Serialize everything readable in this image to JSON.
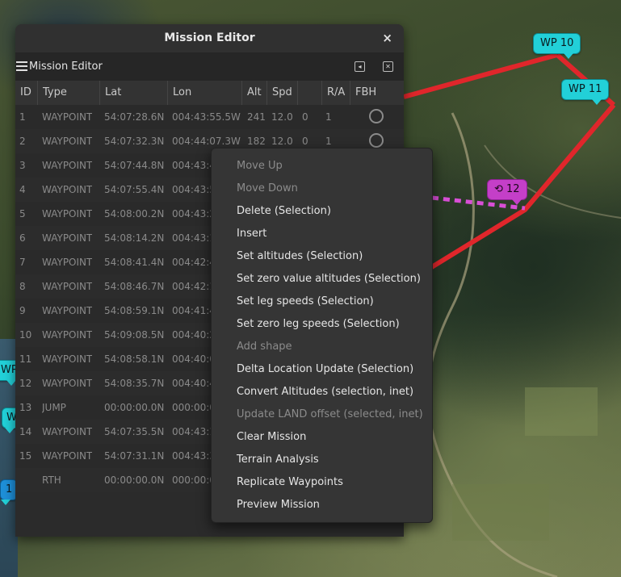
{
  "map": {
    "markers": [
      {
        "label": "WP 10"
      },
      {
        "label": "WP 11"
      },
      {
        "label": "⟲ 12"
      }
    ],
    "left_markers": [
      {
        "label": "WP"
      },
      {
        "label": "W"
      },
      {
        "label": "1"
      }
    ]
  },
  "window": {
    "title": "Mission Editor",
    "close_symbol": "×"
  },
  "editor": {
    "panel_title": "Mission Editor",
    "columns": [
      "ID",
      "Type",
      "Lat",
      "Lon",
      "Alt",
      "Spd",
      "",
      "R/A",
      "FBH"
    ],
    "rows": [
      {
        "id": "1",
        "type": "WAYPOINT",
        "lat": "54:07:28.6N",
        "lon": "004:43:55.5W",
        "alt": "241",
        "spd": "12.0",
        "p": "0",
        "ra": "1"
      },
      {
        "id": "2",
        "type": "WAYPOINT",
        "lat": "54:07:32.3N",
        "lon": "004:44:07.3W",
        "alt": "182",
        "spd": "12.0",
        "p": "0",
        "ra": "1"
      },
      {
        "id": "3",
        "type": "WAYPOINT",
        "lat": "54:07:44.8N",
        "lon": "004:43:4",
        "alt": "",
        "spd": "",
        "p": "",
        "ra": ""
      },
      {
        "id": "4",
        "type": "WAYPOINT",
        "lat": "54:07:55.4N",
        "lon": "004:43:5",
        "alt": "",
        "spd": "",
        "p": "",
        "ra": ""
      },
      {
        "id": "5",
        "type": "WAYPOINT",
        "lat": "54:08:00.2N",
        "lon": "004:43:2",
        "alt": "",
        "spd": "",
        "p": "",
        "ra": ""
      },
      {
        "id": "6",
        "type": "WAYPOINT",
        "lat": "54:08:14.2N",
        "lon": "004:43:1",
        "alt": "",
        "spd": "",
        "p": "",
        "ra": ""
      },
      {
        "id": "7",
        "type": "WAYPOINT",
        "lat": "54:08:41.4N",
        "lon": "004:42:4",
        "alt": "",
        "spd": "",
        "p": "",
        "ra": ""
      },
      {
        "id": "8",
        "type": "WAYPOINT",
        "lat": "54:08:46.7N",
        "lon": "004:42:1",
        "alt": "",
        "spd": "",
        "p": "",
        "ra": ""
      },
      {
        "id": "9",
        "type": "WAYPOINT",
        "lat": "54:08:59.1N",
        "lon": "004:41:4",
        "alt": "",
        "spd": "",
        "p": "",
        "ra": ""
      },
      {
        "id": "10",
        "type": "WAYPOINT",
        "lat": "54:09:08.5N",
        "lon": "004:40:2",
        "alt": "",
        "spd": "",
        "p": "",
        "ra": ""
      },
      {
        "id": "11",
        "type": "WAYPOINT",
        "lat": "54:08:58.1N",
        "lon": "004:40:0",
        "alt": "",
        "spd": "",
        "p": "",
        "ra": ""
      },
      {
        "id": "12",
        "type": "WAYPOINT",
        "lat": "54:08:35.7N",
        "lon": "004:40:4",
        "alt": "",
        "spd": "",
        "p": "",
        "ra": ""
      },
      {
        "id": "13",
        "type": "JUMP",
        "lat": "00:00:00.0N",
        "lon": "000:00:0",
        "alt": "",
        "spd": "",
        "p": "",
        "ra": ""
      },
      {
        "id": "14",
        "type": "WAYPOINT",
        "lat": "54:07:35.5N",
        "lon": "004:43:1",
        "alt": "",
        "spd": "",
        "p": "",
        "ra": ""
      },
      {
        "id": "15",
        "type": "WAYPOINT",
        "lat": "54:07:31.1N",
        "lon": "004:43:3",
        "alt": "",
        "spd": "",
        "p": "",
        "ra": ""
      },
      {
        "id": "",
        "type": "RTH",
        "lat": "00:00:00.0N",
        "lon": "000:00:0",
        "alt": "",
        "spd": "",
        "p": "",
        "ra": ""
      }
    ]
  },
  "context_menu": {
    "items": [
      {
        "label": "Move Up",
        "enabled": false
      },
      {
        "label": "Move Down",
        "enabled": false
      },
      {
        "label": "Delete (Selection)",
        "enabled": true
      },
      {
        "label": "Insert",
        "enabled": true
      },
      {
        "label": "Set altitudes (Selection)",
        "enabled": true
      },
      {
        "label": "Set zero value altitudes (Selection)",
        "enabled": true
      },
      {
        "label": "Set leg speeds (Selection)",
        "enabled": true
      },
      {
        "label": "Set zero leg speeds (Selection)",
        "enabled": true
      },
      {
        "label": "Add shape",
        "enabled": false
      },
      {
        "label": "Delta Location Update (Selection)",
        "enabled": true
      },
      {
        "label": "Convert Altitudes (selection, inet)",
        "enabled": true
      },
      {
        "label": "Update LAND offset (selected, inet)",
        "enabled": false
      },
      {
        "label": "Clear Mission",
        "enabled": true
      },
      {
        "label": "Terrain Analysis",
        "enabled": true
      },
      {
        "label": "Replicate Waypoints",
        "enabled": true
      },
      {
        "label": "Preview Mission",
        "enabled": true
      }
    ]
  },
  "colors": {
    "route": "#e0262b",
    "jump_path": "#d84fd6",
    "waypoint_marker": "#22d0d8",
    "jump_marker": "#c43fc8"
  }
}
